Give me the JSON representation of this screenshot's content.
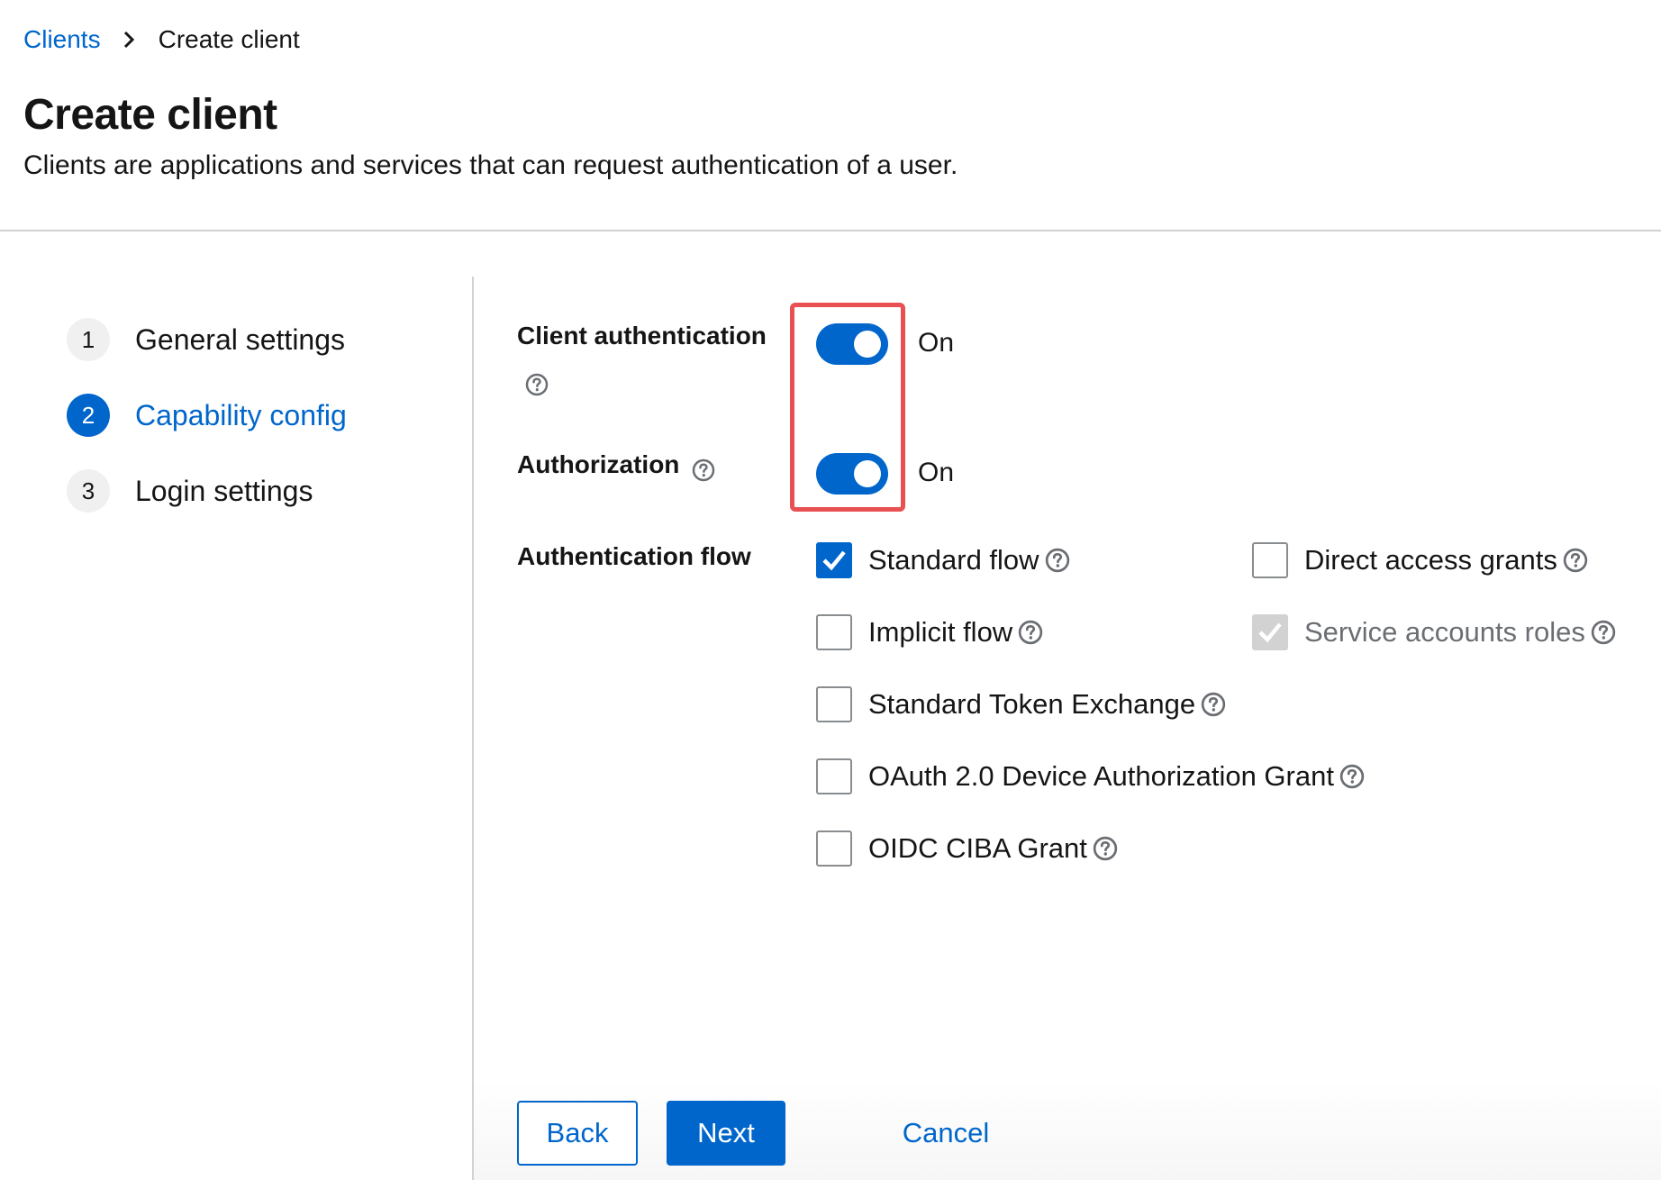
{
  "breadcrumb": {
    "parent": "Clients",
    "current": "Create client"
  },
  "header": {
    "title": "Create client",
    "description": "Clients are applications and services that can request authentication of a user."
  },
  "wizard": {
    "steps": [
      {
        "number": "1",
        "label": "General settings",
        "active": false
      },
      {
        "number": "2",
        "label": "Capability config",
        "active": true
      },
      {
        "number": "3",
        "label": "Login settings",
        "active": false
      }
    ]
  },
  "form": {
    "client_auth": {
      "label": "Client authentication",
      "state_text": "On",
      "enabled": true
    },
    "authorization": {
      "label": "Authorization",
      "state_text": "On",
      "enabled": true
    },
    "auth_flow": {
      "label": "Authentication flow",
      "options": [
        {
          "label": "Standard flow",
          "checked": true,
          "disabled": false
        },
        {
          "label": "Direct access grants",
          "checked": false,
          "disabled": false
        },
        {
          "label": "Implicit flow",
          "checked": false,
          "disabled": false
        },
        {
          "label": "Service accounts roles",
          "checked": true,
          "disabled": true
        },
        {
          "label": "Standard Token Exchange",
          "checked": false,
          "disabled": false
        },
        {
          "label": "OAuth 2.0 Device Authorization Grant",
          "checked": false,
          "disabled": false
        },
        {
          "label": "OIDC CIBA Grant",
          "checked": false,
          "disabled": false
        }
      ]
    }
  },
  "footer": {
    "back_label": "Back",
    "next_label": "Next",
    "cancel_label": "Cancel"
  },
  "colors": {
    "primary": "#0066cc",
    "highlight": "#e95052",
    "disabled": "#d2d2d2"
  },
  "icons": {
    "breadcrumb_separator": "chevron-right-icon",
    "help": "question-circle-icon",
    "check": "check-icon"
  }
}
